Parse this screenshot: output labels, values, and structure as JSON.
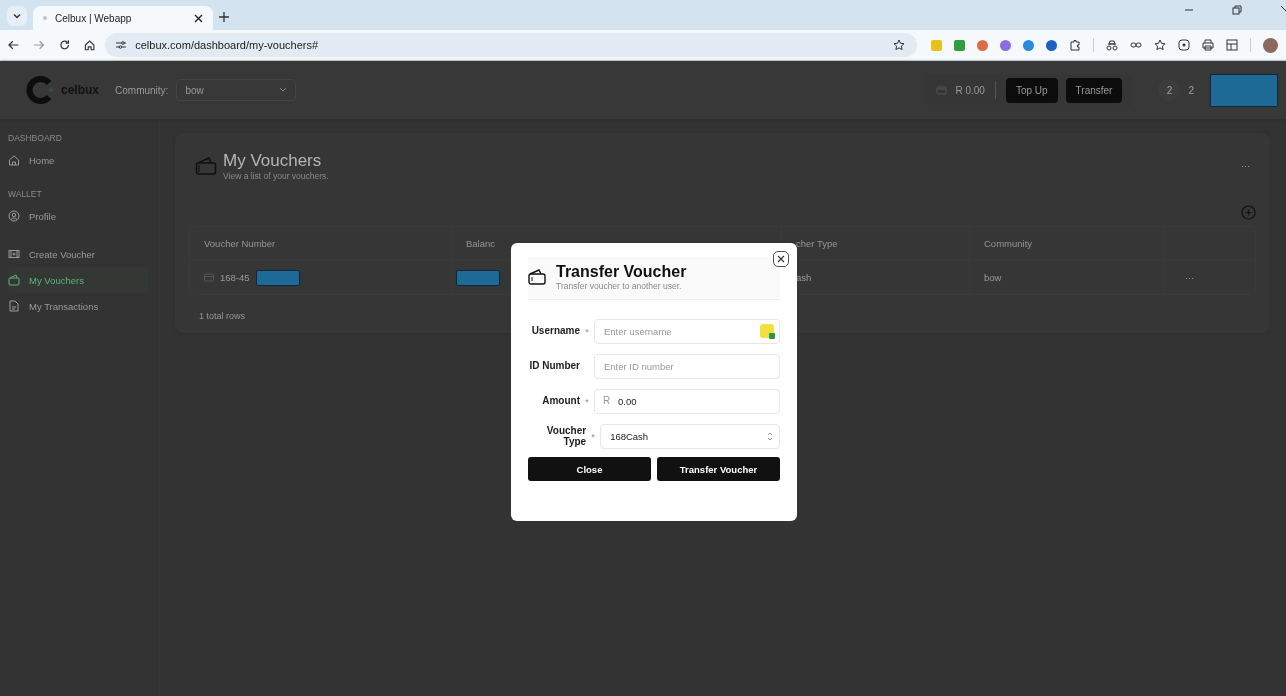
{
  "browser": {
    "tabs": [
      {
        "title": "Celbux | Webapp",
        "selected": true
      }
    ],
    "url": "celbux.com/dashboard/my-vouchers#"
  },
  "header": {
    "logo": "celbux",
    "community_label": "Community:",
    "community_value": "bow",
    "balance": "R 0.00",
    "buttons": [
      "Top Up",
      "Transfer"
    ],
    "avatar_initial": "2",
    "user_text": "2"
  },
  "sidebar": {
    "sections": [
      {
        "heading": "DASHBOARD",
        "items": [
          {
            "label": "Home",
            "selected": false
          }
        ]
      },
      {
        "heading": "WALLET",
        "items": [
          {
            "label": "Profile",
            "selected": false
          },
          {
            "label": "Create Voucher",
            "selected": false
          },
          {
            "label": "My Vouchers",
            "selected": true
          },
          {
            "label": "My Transactions",
            "selected": false
          }
        ]
      }
    ]
  },
  "page": {
    "title": "My Vouchers",
    "subtitle": "View a list of your vouchers.",
    "more": "···"
  },
  "table": {
    "columns": [
      "Voucher Number",
      "Balanc",
      "cher Type",
      "Community"
    ],
    "rows": [
      {
        "voucher_number": "168-45",
        "voucher_type": "ash",
        "community": "bow",
        "action": "···"
      }
    ],
    "footer": "1 total rows"
  },
  "modal": {
    "title": "Transfer Voucher",
    "subtitle": "Transfer voucher to another user.",
    "fields": [
      {
        "kind": "text",
        "label": "Username",
        "required_mark": "*",
        "placeholder": "Enter username"
      },
      {
        "kind": "text",
        "label": "ID Number",
        "placeholder": "Enter ID number"
      },
      {
        "kind": "currency",
        "label": "Amount",
        "required_mark": "*",
        "prefix": "R",
        "value": "0.00"
      },
      {
        "kind": "select",
        "label": "Voucher Type",
        "required_mark": "*",
        "value": "168Cash"
      }
    ],
    "buttons": [
      "Close",
      "Transfer Voucher"
    ]
  }
}
